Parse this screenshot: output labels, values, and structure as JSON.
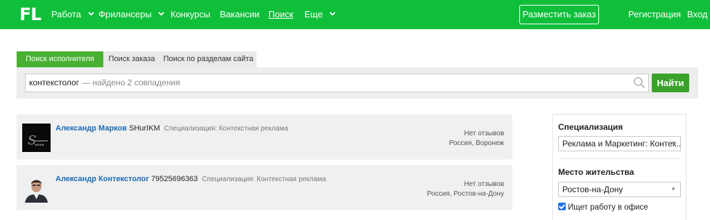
{
  "header": {
    "logo": "FL",
    "nav": [
      {
        "label": "Работа",
        "has_dropdown": true
      },
      {
        "label": "Фрилансеры",
        "has_dropdown": true
      },
      {
        "label": "Конкурсы",
        "has_dropdown": false
      },
      {
        "label": "Вакансии",
        "has_dropdown": false
      },
      {
        "label": "Поиск",
        "has_dropdown": false,
        "active": true
      },
      {
        "label": "Еще",
        "has_dropdown": true
      }
    ],
    "post_order_label": "Разместить заказ",
    "register_label": "Регистрация",
    "login_label": "Вход",
    "brand_color": "#0fbf3a"
  },
  "tabs": [
    {
      "label": "Поиск исполнителя",
      "active": true
    },
    {
      "label": "Поиск заказа",
      "active": false
    },
    {
      "label": "Поиск по разделам сайта",
      "active": false
    }
  ],
  "search": {
    "query": "контекстолог",
    "found_text": "— найдено 2 совпадения",
    "icon": "magnifier-icon",
    "button_label": "Найти",
    "button_color": "#3aa22a"
  },
  "results": [
    {
      "name": "Александр Марков",
      "login": "SHurIKM",
      "spec": "Специализация: Контекстная реклама",
      "reviews": "Нет отзывов",
      "location": "Россия, Воронеж"
    },
    {
      "name": "Александр Контекстолог",
      "login": "79525696363",
      "spec": "Специализация: Контекстная реклама",
      "reviews": "Нет отзывов",
      "location": "Россия, Ростов-на-Дону"
    }
  ],
  "sidebar": {
    "spec_title": "Специализация",
    "spec_value": "Реклама и Маркетинг: Контек...",
    "residence_title": "Место жительства",
    "residence_value": "Ростов-на-Дону",
    "office_label": "Ищет работу в офисе",
    "office_checked": true
  }
}
